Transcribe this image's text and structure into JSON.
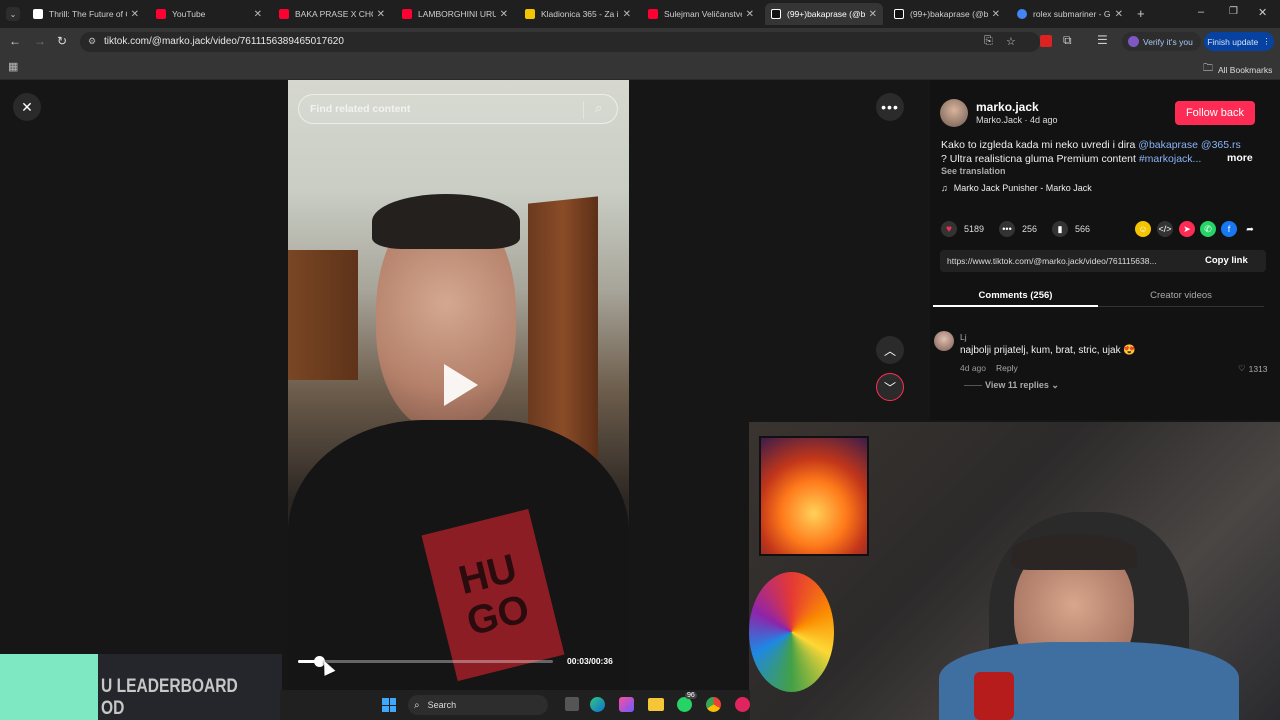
{
  "browser": {
    "tabs": [
      {
        "label": "Thrill: The Future of C",
        "favicon_color": "#ffffff"
      },
      {
        "label": "YouTube",
        "favicon_color": "#ff0033"
      },
      {
        "label": "BAKA PRASE X CHOC",
        "favicon_color": "#ff0033"
      },
      {
        "label": "LAMBORGHINI URUS",
        "favicon_color": "#ff0033"
      },
      {
        "label": "Kladionica 365 - Za i",
        "favicon_color": "#f5c400"
      },
      {
        "label": "Sulejman Veličanstve",
        "favicon_color": "#ff0033"
      },
      {
        "label": "(99+)bakaprase (@b",
        "favicon_color": "#ffffff"
      },
      {
        "label": "(99+)bakaprase (@b",
        "favicon_color": "#ffffff"
      },
      {
        "label": "rolex submariner - G",
        "favicon_color": "#4285f4"
      }
    ],
    "url": "tiktok.com/@marko.jack/video/7611156389465017620",
    "verify_label": "Verify it's you",
    "finish_update_label": "Finish update",
    "all_bookmarks_label": "All Bookmarks",
    "accent": "#8ab4f8"
  },
  "player": {
    "search_placeholder": "Find related content",
    "time": "00:03/00:36",
    "progress": 0.083
  },
  "video": {
    "shirt_text_1": "HU",
    "shirt_text_2": "GO"
  },
  "post": {
    "username": "marko.jack",
    "subline": "Marko.Jack · 4d ago",
    "follow_label": "Follow back",
    "caption_text": "Kako to izgleda kada mi neko uvredi i dira ",
    "mention_1": "@bakaprase",
    "mention_2": "@365.rs",
    "caption_line2": "? Ultra realisticna gluma Premium content ",
    "hashtag": "#markojack...",
    "more_label": "more",
    "see_translation": "See translation",
    "music": "Marko Jack Punisher - Marko Jack",
    "likes": "5189",
    "comments": "256",
    "saves": "566",
    "share_url": "https://www.tiktok.com/@marko.jack/video/761115638...",
    "copy_link": "Copy link",
    "accent": "#fe2c55"
  },
  "tabs_panel": {
    "comments_tab": "Comments (256)",
    "creator_tab": "Creator videos"
  },
  "comment": {
    "author": "Lj",
    "text": "najbolji prijatelj, kum, brat, stric, ujak 😍",
    "time": "4d ago",
    "reply_label": "Reply",
    "likes": "1313",
    "view_replies": "View 11 replies"
  },
  "overlay": {
    "leaderboard_text": "U LEADERBOARD OD",
    "taskbar_search": "Search",
    "badge_count": "96"
  }
}
